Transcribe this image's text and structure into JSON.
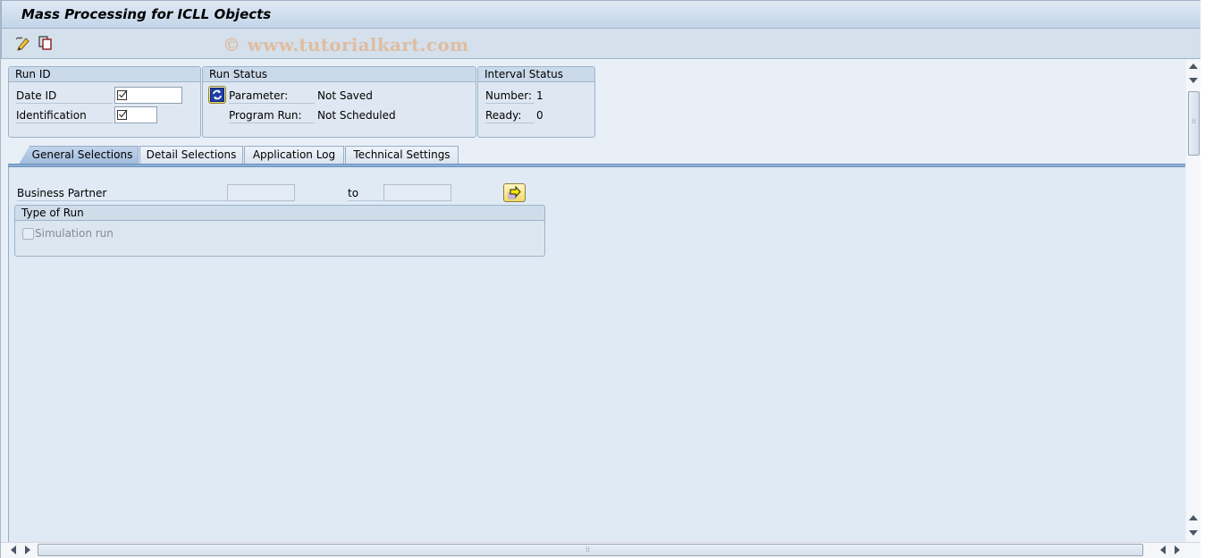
{
  "window": {
    "title": "Mass Processing for ICLL Objects",
    "watermark": "© www.tutorialkart.com"
  },
  "toolbar": {
    "items": [
      {
        "icon": "edit-pencil-icon",
        "tooltip": ""
      },
      {
        "icon": "copy-icon",
        "tooltip": ""
      }
    ]
  },
  "run_id": {
    "title": "Run ID",
    "fields": [
      {
        "label": "Date ID",
        "value": "",
        "required_check": true
      },
      {
        "label": "Identification",
        "value": "",
        "required_check": true
      }
    ]
  },
  "run_status": {
    "title": "Run Status",
    "refresh_icon": "refresh-icon",
    "rows": [
      {
        "label": "Parameter:",
        "value": "Not Saved"
      },
      {
        "label": "Program Run:",
        "value": "Not Scheduled"
      }
    ]
  },
  "interval_status": {
    "title": "Interval Status",
    "rows": [
      {
        "label": "Number:",
        "value": "1"
      },
      {
        "label": "Ready:",
        "value": "0"
      }
    ]
  },
  "tabs": [
    {
      "label": "General Selections",
      "active": true
    },
    {
      "label": "Detail Selections",
      "active": false
    },
    {
      "label": "Application Log",
      "active": false
    },
    {
      "label": "Technical Settings",
      "active": false
    }
  ],
  "general_selections": {
    "business_partner": {
      "label": "Business Partner",
      "from_value": "",
      "to_label": "to",
      "to_value": "",
      "multiple_selection_icon": "multiple-selection-arrow-icon"
    },
    "type_of_run": {
      "title": "Type of Run",
      "simulation_run": {
        "label": "Simulation run",
        "checked": false,
        "enabled": false
      }
    }
  }
}
